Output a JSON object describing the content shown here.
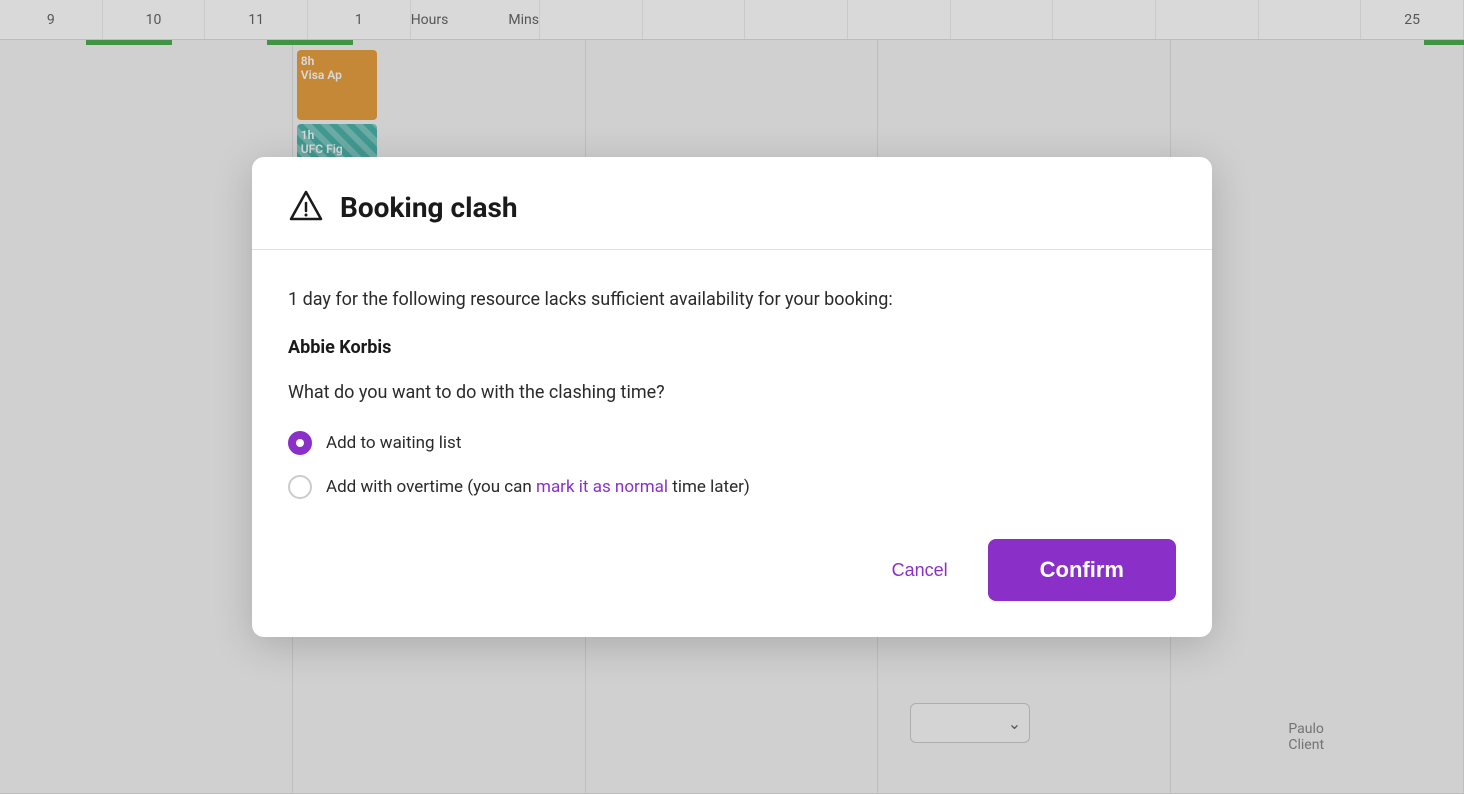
{
  "calendar": {
    "columns": [
      "9",
      "10",
      "11",
      "1",
      "",
      "",
      "",
      "",
      "",
      "",
      "",
      "",
      "",
      "25"
    ],
    "event1": {
      "duration": "8h",
      "title": "Visa Ap"
    },
    "event2": {
      "duration": "1h",
      "title": "UFC Fig"
    },
    "hours_label": "Hours",
    "mins_label": "Mins",
    "bottom_text": "Paulo Client"
  },
  "modal": {
    "title": "Booking clash",
    "description": "1 day for the following resource lacks sufficient availability for your booking:",
    "resource_name": "Abbie Korbis",
    "question": "What do you want to do with the clashing time?",
    "radio_option1": "Add to waiting list",
    "radio_option2_prefix": "Add with overtime (you can ",
    "radio_option2_link": "mark it as normal",
    "radio_option2_suffix": " time later)",
    "cancel_label": "Cancel",
    "confirm_label": "Confirm"
  }
}
